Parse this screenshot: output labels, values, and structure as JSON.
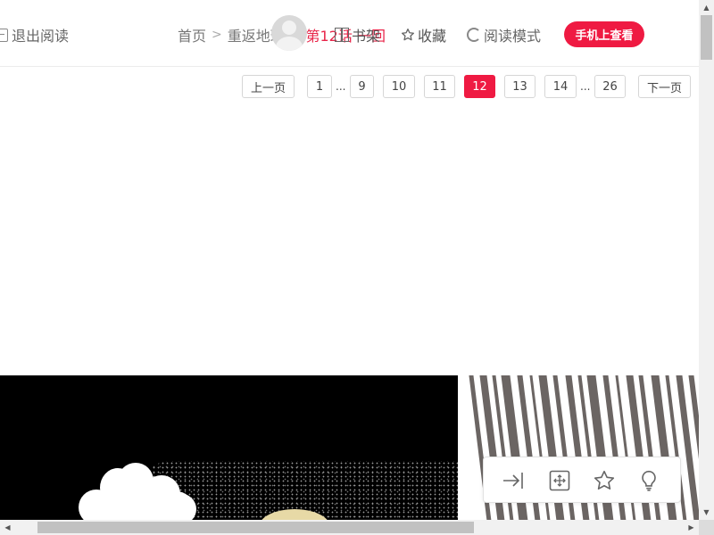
{
  "header": {
    "exit_label": "退出阅读",
    "breadcrumbs": [
      {
        "label": "首页"
      },
      {
        "label": "重返地球"
      },
      {
        "label": "第12话 一回"
      }
    ],
    "bookshelf_label": "书架",
    "favorite_label": "收藏",
    "reading_mode_label": "阅读模式",
    "phone_button_label": "手机上查看"
  },
  "pagination": {
    "prev_label": "上一页",
    "next_label": "下一页",
    "ellipsis": "...",
    "pages": [
      "1",
      "9",
      "10",
      "11",
      "12",
      "13",
      "14",
      "26"
    ],
    "current": "12"
  },
  "toolbar": {
    "icons": [
      "collapse-to-end-icon",
      "fit-screen-icon",
      "star-icon",
      "lightbulb-icon"
    ]
  },
  "colors": {
    "accent": "#ef1a42",
    "breadcrumb_current": "#e8264a",
    "text_muted": "#777777"
  }
}
